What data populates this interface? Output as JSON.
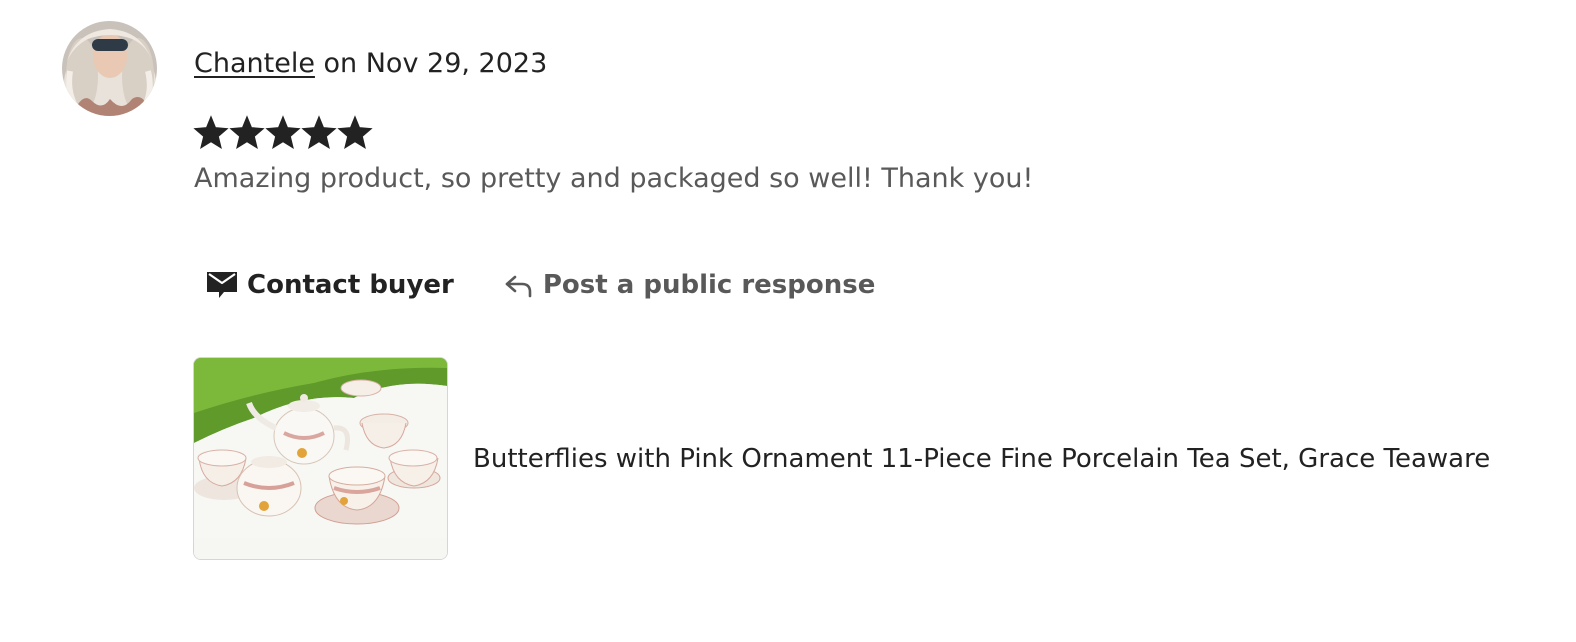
{
  "review": {
    "reviewer_name": "Chantele",
    "date_text": " on Nov 29, 2023",
    "rating": 5,
    "rating_max": 5,
    "text": "Amazing product, so pretty and packaged so well! Thank you!"
  },
  "actions": {
    "contact_label": "Contact buyer",
    "respond_label": "Post a public response"
  },
  "listing": {
    "title": "Butterflies with Pink Ornament 11-Piece Fine Porcelain Tea Set, Grace Teaware"
  },
  "icons": {
    "star": "star-filled-icon",
    "contact": "mail-icon",
    "respond": "reply-arrow-icon"
  },
  "colors": {
    "text_primary": "#222222",
    "text_secondary": "#595959",
    "star": "#222222"
  }
}
